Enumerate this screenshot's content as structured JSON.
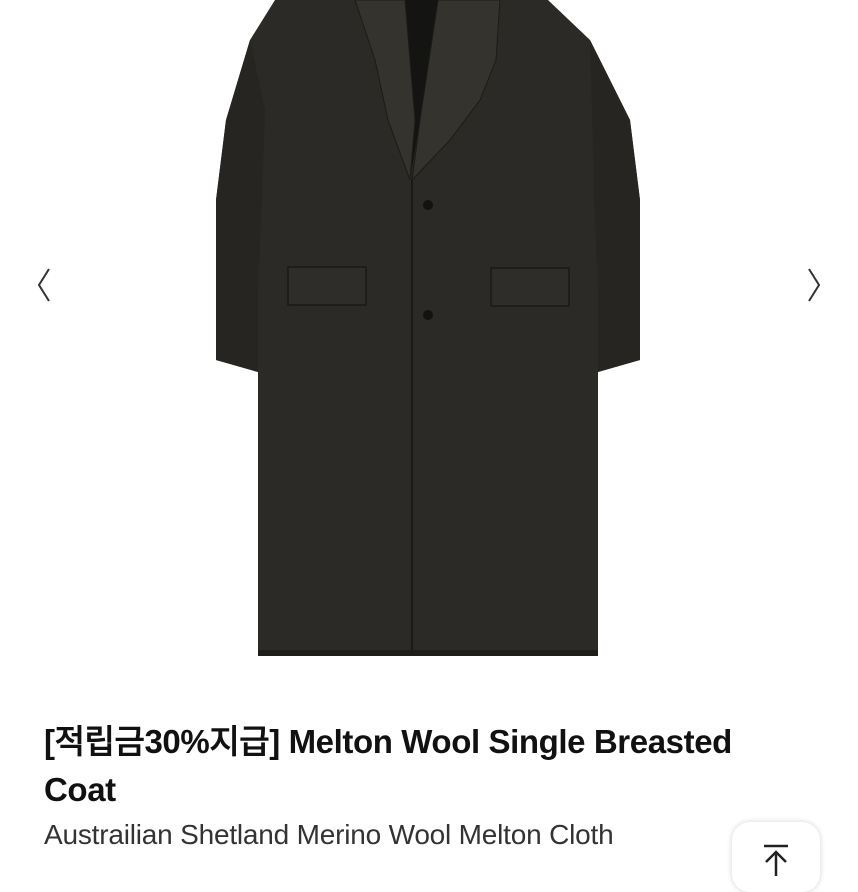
{
  "product": {
    "image_alt": "Melton Wool Single Breasted Coat",
    "title": "[적립금30%지급] Melton Wool Single Breasted Coat",
    "subtitle": "Austrailian Shetland Merino Wool Melton Cloth"
  },
  "gallery": {
    "prev_icon": "chevron-left-icon",
    "next_icon": "chevron-right-icon"
  },
  "scroll_top_icon": "arrow-up-to-top-icon",
  "colors": {
    "coat": "#2b2a26",
    "coat_shadow": "#1e1d1a",
    "text": "#111111"
  }
}
